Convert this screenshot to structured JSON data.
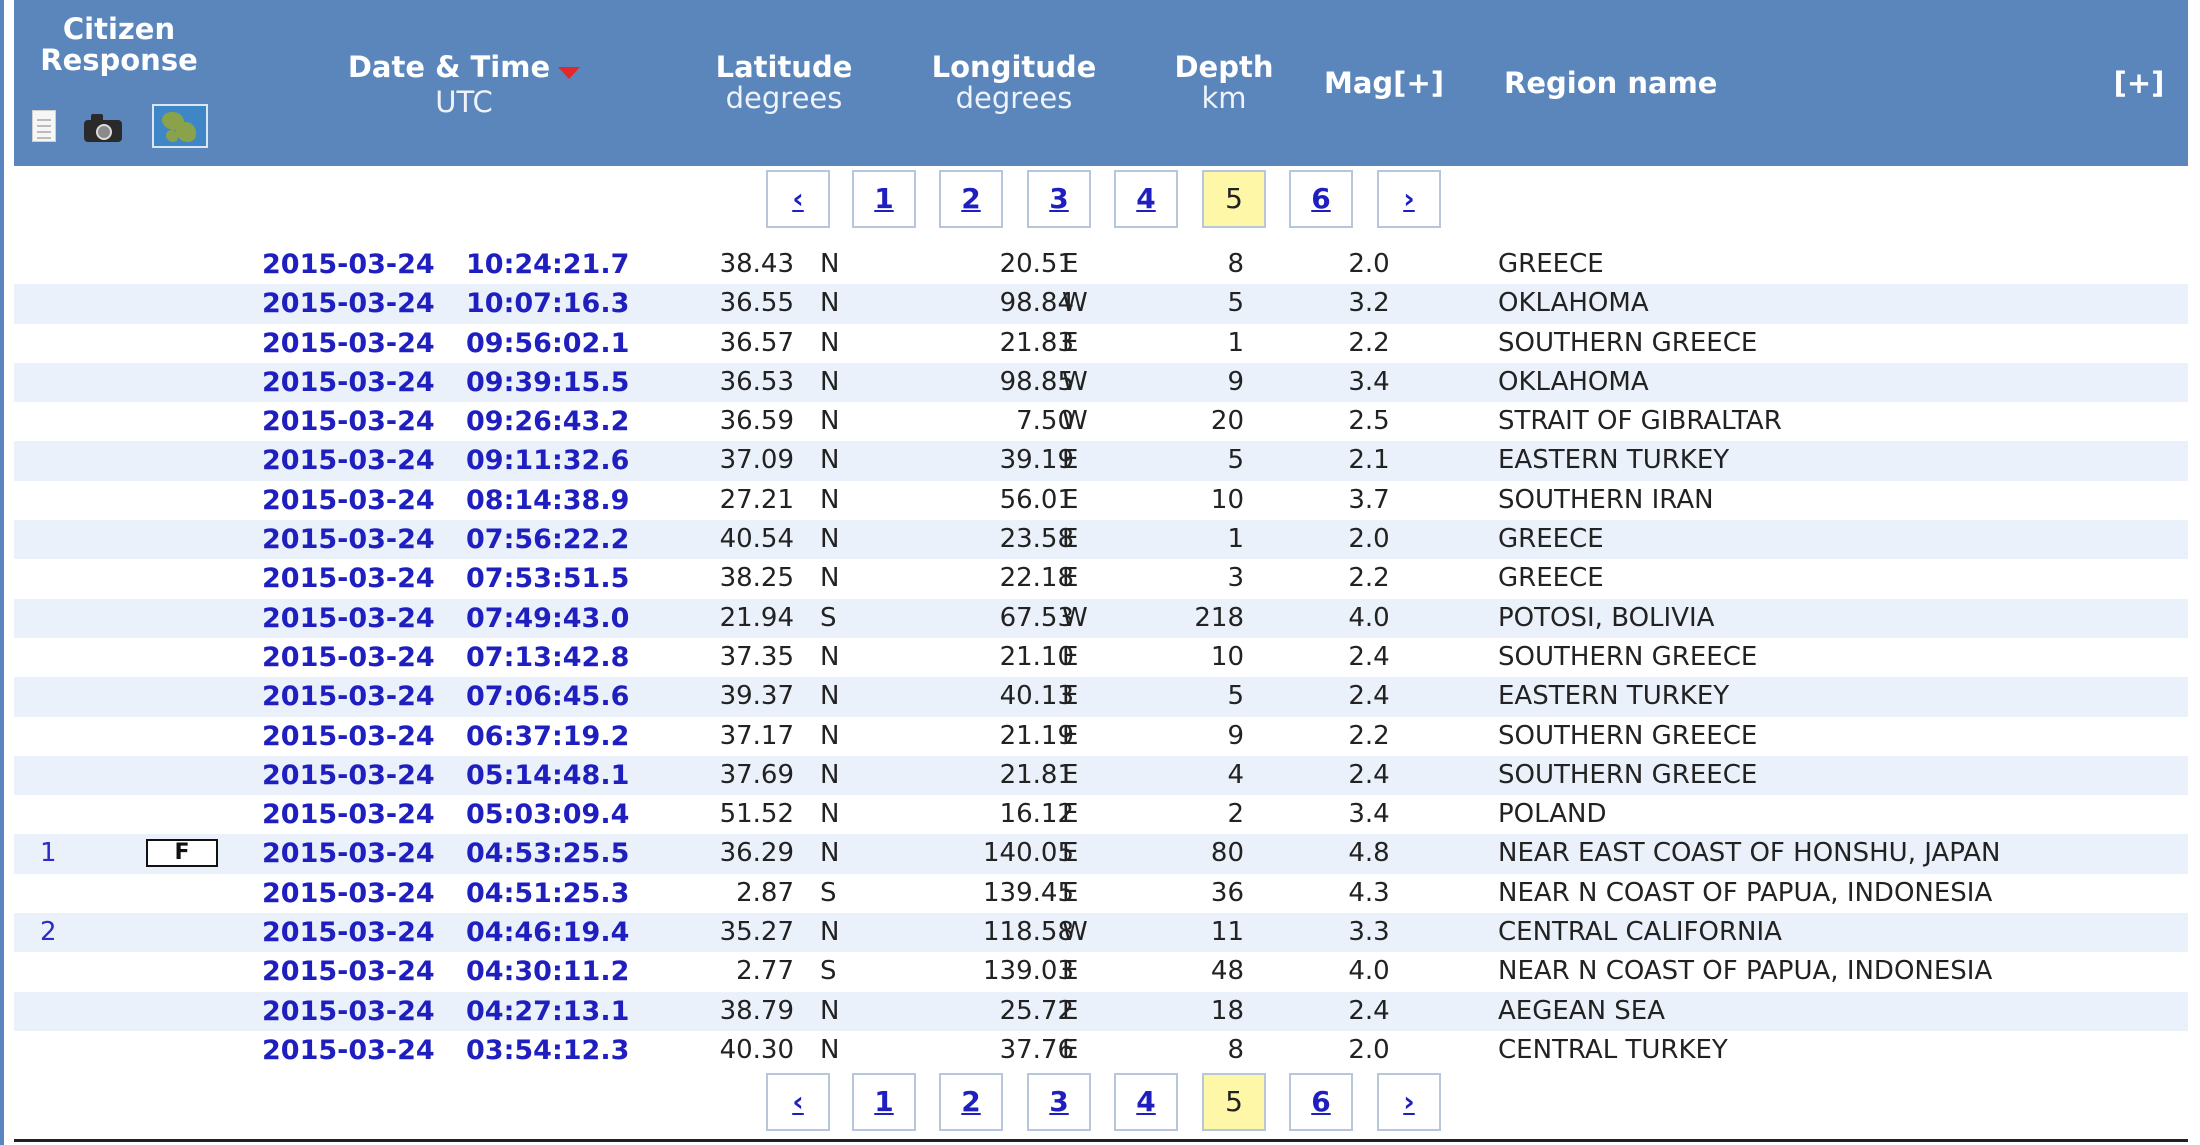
{
  "header": {
    "citizen_line1": "Citizen",
    "citizen_line2": "Response",
    "datetime_title": "Date & Time",
    "datetime_unit": "UTC",
    "lat_title": "Latitude",
    "lat_unit": "degrees",
    "lon_title": "Longitude",
    "lon_unit": "degrees",
    "depth_title": "Depth",
    "depth_unit": "km",
    "mag_title": "Mag[+]",
    "region_title": "Region name",
    "expand_label": "[+]"
  },
  "icons": [
    "document-icon",
    "camera-icon",
    "map-icon"
  ],
  "colors": {
    "header_bg": "#5b86bc",
    "link": "#1f1fc0",
    "current_page_bg": "#fff7a8",
    "alt_row": "#eaf1fa"
  },
  "pagination": {
    "prev": "‹",
    "next": "›",
    "pages": [
      "1",
      "2",
      "3",
      "4",
      "5",
      "6"
    ],
    "current": "5"
  },
  "rows": [
    {
      "resp": "",
      "f": "",
      "date": "2015-03-24",
      "time": "10:24:21.7",
      "lat": "38.43",
      "ns": "N",
      "lon": "20.51",
      "ew": "E",
      "depth": "8",
      "mag": "2.0",
      "region": "GREECE"
    },
    {
      "resp": "",
      "f": "",
      "date": "2015-03-24",
      "time": "10:07:16.3",
      "lat": "36.55",
      "ns": "N",
      "lon": "98.84",
      "ew": "W",
      "depth": "5",
      "mag": "3.2",
      "region": "OKLAHOMA"
    },
    {
      "resp": "",
      "f": "",
      "date": "2015-03-24",
      "time": "09:56:02.1",
      "lat": "36.57",
      "ns": "N",
      "lon": "21.83",
      "ew": "E",
      "depth": "1",
      "mag": "2.2",
      "region": "SOUTHERN GREECE"
    },
    {
      "resp": "",
      "f": "",
      "date": "2015-03-24",
      "time": "09:39:15.5",
      "lat": "36.53",
      "ns": "N",
      "lon": "98.85",
      "ew": "W",
      "depth": "9",
      "mag": "3.4",
      "region": "OKLAHOMA"
    },
    {
      "resp": "",
      "f": "",
      "date": "2015-03-24",
      "time": "09:26:43.2",
      "lat": "36.59",
      "ns": "N",
      "lon": "7.50",
      "ew": "W",
      "depth": "20",
      "mag": "2.5",
      "region": "STRAIT OF GIBRALTAR"
    },
    {
      "resp": "",
      "f": "",
      "date": "2015-03-24",
      "time": "09:11:32.6",
      "lat": "37.09",
      "ns": "N",
      "lon": "39.19",
      "ew": "E",
      "depth": "5",
      "mag": "2.1",
      "region": "EASTERN TURKEY"
    },
    {
      "resp": "",
      "f": "",
      "date": "2015-03-24",
      "time": "08:14:38.9",
      "lat": "27.21",
      "ns": "N",
      "lon": "56.01",
      "ew": "E",
      "depth": "10",
      "mag": "3.7",
      "region": "SOUTHERN IRAN"
    },
    {
      "resp": "",
      "f": "",
      "date": "2015-03-24",
      "time": "07:56:22.2",
      "lat": "40.54",
      "ns": "N",
      "lon": "23.58",
      "ew": "E",
      "depth": "1",
      "mag": "2.0",
      "region": "GREECE"
    },
    {
      "resp": "",
      "f": "",
      "date": "2015-03-24",
      "time": "07:53:51.5",
      "lat": "38.25",
      "ns": "N",
      "lon": "22.18",
      "ew": "E",
      "depth": "3",
      "mag": "2.2",
      "region": "GREECE"
    },
    {
      "resp": "",
      "f": "",
      "date": "2015-03-24",
      "time": "07:49:43.0",
      "lat": "21.94",
      "ns": "S",
      "lon": "67.53",
      "ew": "W",
      "depth": "218",
      "mag": "4.0",
      "region": "POTOSI, BOLIVIA"
    },
    {
      "resp": "",
      "f": "",
      "date": "2015-03-24",
      "time": "07:13:42.8",
      "lat": "37.35",
      "ns": "N",
      "lon": "21.10",
      "ew": "E",
      "depth": "10",
      "mag": "2.4",
      "region": "SOUTHERN GREECE"
    },
    {
      "resp": "",
      "f": "",
      "date": "2015-03-24",
      "time": "07:06:45.6",
      "lat": "39.37",
      "ns": "N",
      "lon": "40.13",
      "ew": "E",
      "depth": "5",
      "mag": "2.4",
      "region": "EASTERN TURKEY"
    },
    {
      "resp": "",
      "f": "",
      "date": "2015-03-24",
      "time": "06:37:19.2",
      "lat": "37.17",
      "ns": "N",
      "lon": "21.19",
      "ew": "E",
      "depth": "9",
      "mag": "2.2",
      "region": "SOUTHERN GREECE"
    },
    {
      "resp": "",
      "f": "",
      "date": "2015-03-24",
      "time": "05:14:48.1",
      "lat": "37.69",
      "ns": "N",
      "lon": "21.81",
      "ew": "E",
      "depth": "4",
      "mag": "2.4",
      "region": "SOUTHERN GREECE"
    },
    {
      "resp": "",
      "f": "",
      "date": "2015-03-24",
      "time": "05:03:09.4",
      "lat": "51.52",
      "ns": "N",
      "lon": "16.12",
      "ew": "E",
      "depth": "2",
      "mag": "3.4",
      "region": "POLAND"
    },
    {
      "resp": "1",
      "f": "F",
      "date": "2015-03-24",
      "time": "04:53:25.5",
      "lat": "36.29",
      "ns": "N",
      "lon": "140.05",
      "ew": "E",
      "depth": "80",
      "mag": "4.8",
      "region": "NEAR EAST COAST OF HONSHU, JAPAN"
    },
    {
      "resp": "",
      "f": "",
      "date": "2015-03-24",
      "time": "04:51:25.3",
      "lat": "2.87",
      "ns": "S",
      "lon": "139.45",
      "ew": "E",
      "depth": "36",
      "mag": "4.3",
      "region": "NEAR N COAST OF PAPUA, INDONESIA"
    },
    {
      "resp": "2",
      "f": "",
      "date": "2015-03-24",
      "time": "04:46:19.4",
      "lat": "35.27",
      "ns": "N",
      "lon": "118.58",
      "ew": "W",
      "depth": "11",
      "mag": "3.3",
      "region": "CENTRAL CALIFORNIA"
    },
    {
      "resp": "",
      "f": "",
      "date": "2015-03-24",
      "time": "04:30:11.2",
      "lat": "2.77",
      "ns": "S",
      "lon": "139.03",
      "ew": "E",
      "depth": "48",
      "mag": "4.0",
      "region": "NEAR N COAST OF PAPUA, INDONESIA"
    },
    {
      "resp": "",
      "f": "",
      "date": "2015-03-24",
      "time": "04:27:13.1",
      "lat": "38.79",
      "ns": "N",
      "lon": "25.72",
      "ew": "E",
      "depth": "18",
      "mag": "2.4",
      "region": "AEGEAN SEA"
    },
    {
      "resp": "",
      "f": "",
      "date": "2015-03-24",
      "time": "03:54:12.3",
      "lat": "40.30",
      "ns": "N",
      "lon": "37.76",
      "ew": "E",
      "depth": "8",
      "mag": "2.0",
      "region": "CENTRAL TURKEY"
    }
  ]
}
